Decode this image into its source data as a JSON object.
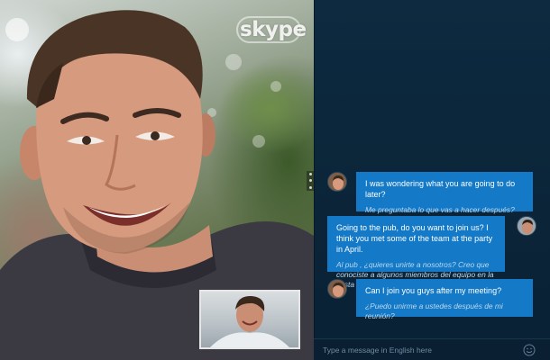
{
  "video": {
    "brand": "skype",
    "remote_participant": "remote-video",
    "self_view": "self-video-preview"
  },
  "chat": {
    "messages": [
      {
        "side": "left",
        "original": "I was wondering what you are going to do later?",
        "translation": "Me preguntaba lo que vas a hacer después?"
      },
      {
        "side": "right",
        "original": "Going to the pub, do you want to join us? I think you met some of the team at the party in April.",
        "translation": "Al pub , ¿quieres unirte a nosotros? Creo que conociste a algunos miembros del equipo en la fiesta en abril ."
      },
      {
        "side": "left",
        "original": "Can I join you guys after my meeting?",
        "translation": "¿Puedo unirme a ustedes después de mi reunión?"
      }
    ],
    "compose_placeholder": "Type a message in English here"
  },
  "colors": {
    "bubble": "#1479c6",
    "chat_bg": "#0b2438",
    "translation_text": "#bcd9f0"
  },
  "icons": {
    "emoji": "smiley-icon",
    "more": "more-options-icon"
  }
}
